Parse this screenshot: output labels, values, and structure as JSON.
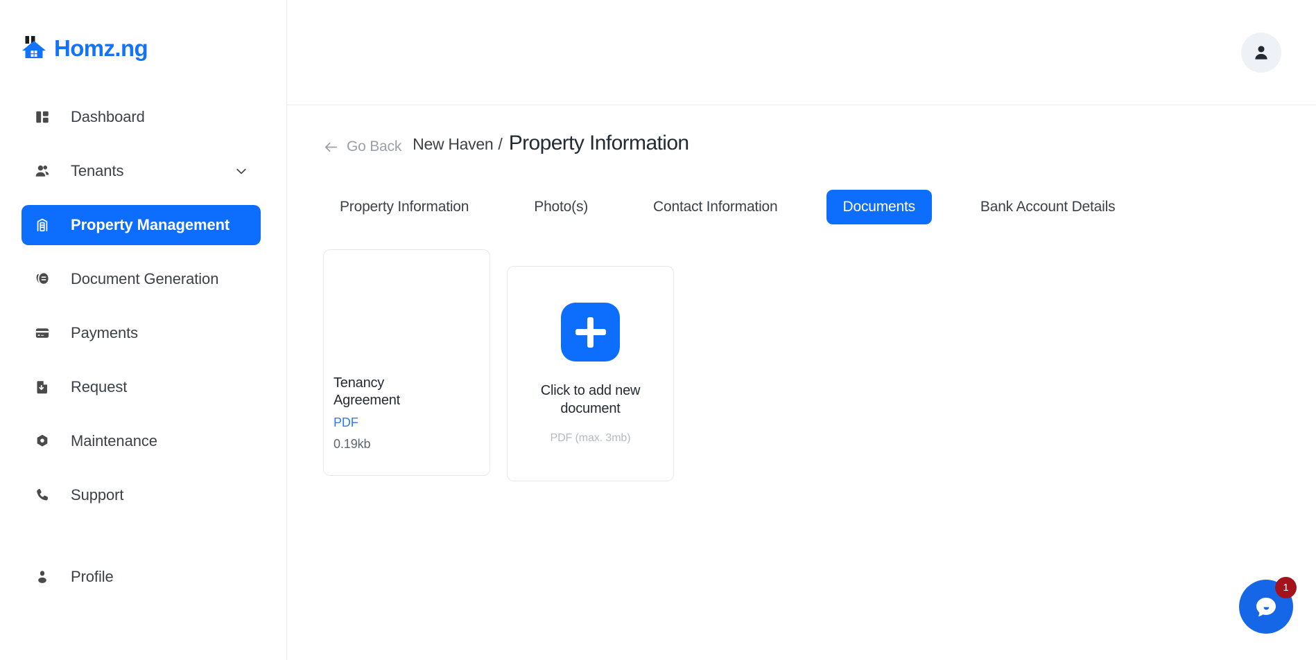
{
  "brand": {
    "name": "Homz.ng",
    "logo_icon": "house-icon",
    "color": "#1473fc"
  },
  "sidebar": {
    "items": [
      {
        "label": "Dashboard",
        "icon": "dashboard-grid-icon",
        "active": false,
        "expandable": false
      },
      {
        "label": "Tenants",
        "icon": "users-icon",
        "active": false,
        "expandable": true
      },
      {
        "label": "Property Management",
        "icon": "building-icon",
        "active": true,
        "expandable": false
      },
      {
        "label": "Document Generation",
        "icon": "document-note-icon",
        "active": false,
        "expandable": false
      },
      {
        "label": "Payments",
        "icon": "credit-card-icon",
        "active": false,
        "expandable": false
      },
      {
        "label": "Request",
        "icon": "file-download-icon",
        "active": false,
        "expandable": false
      },
      {
        "label": "Maintenance",
        "icon": "gear-hex-icon",
        "active": false,
        "expandable": false
      },
      {
        "label": "Support",
        "icon": "phone-icon",
        "active": false,
        "expandable": false
      }
    ],
    "bottom_items": [
      {
        "label": "Profile",
        "icon": "person-icon",
        "active": false,
        "expandable": false
      }
    ]
  },
  "topbar": {
    "avatar_icon": "person-avatar-icon"
  },
  "breadcrumb": {
    "back_icon": "arrow-left-icon",
    "back_label": "Go Back",
    "parent": "New Haven",
    "separator": "/",
    "current": "Property Information"
  },
  "tabs": {
    "items": [
      {
        "label": "Property Information",
        "active": false
      },
      {
        "label": "Photo(s)",
        "active": false
      },
      {
        "label": "Contact Information",
        "active": false
      },
      {
        "label": "Documents",
        "active": true
      },
      {
        "label": "Bank Account Details",
        "active": false
      }
    ],
    "active_color": "#0d6efd"
  },
  "documents": {
    "items": [
      {
        "title": "Tenancy Agreement",
        "type": "PDF",
        "size": "0.19kb"
      }
    ],
    "add_card": {
      "plus_icon": "plus-icon",
      "title": "Click to add new document",
      "hint": "PDF (max. 3mb)"
    }
  },
  "chat": {
    "icon": "chat-bubble-icon",
    "badge_count": "1",
    "button_color": "#1667e8",
    "badge_color": "#a4131c"
  }
}
